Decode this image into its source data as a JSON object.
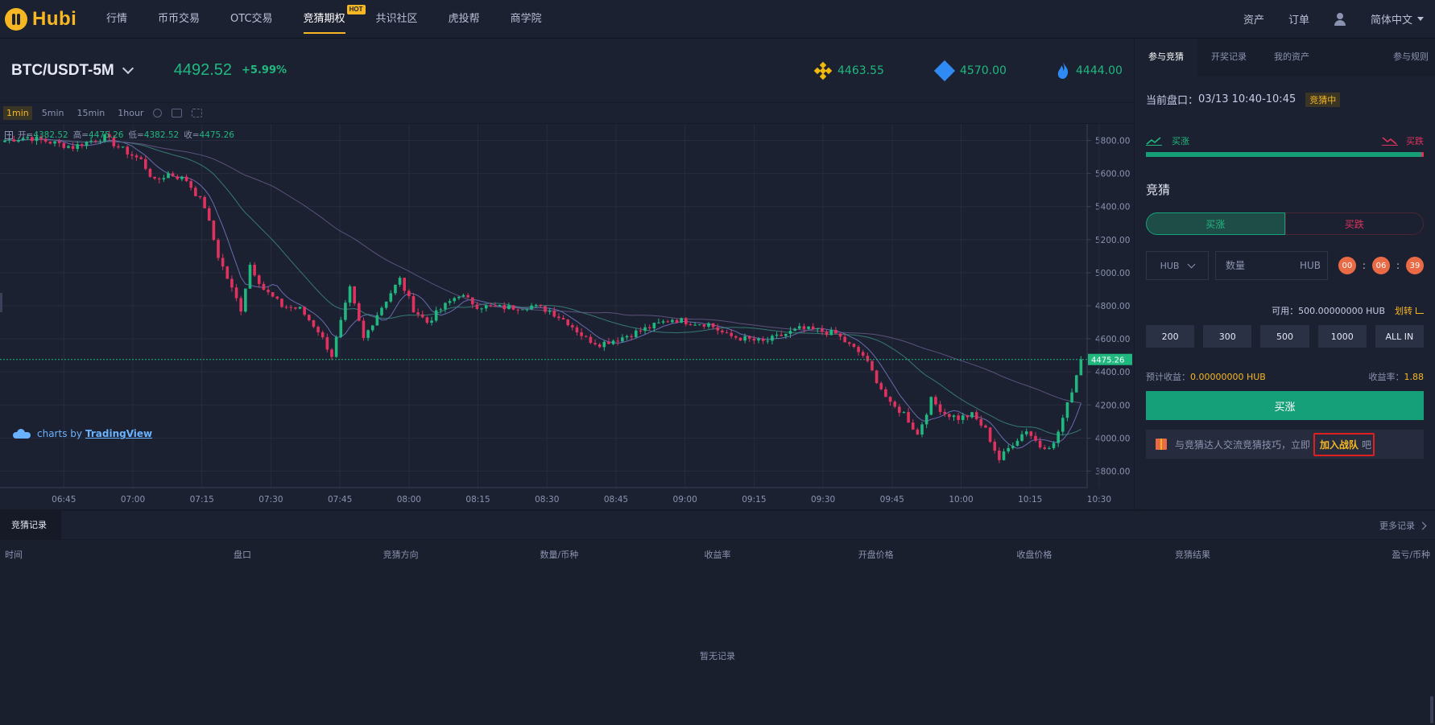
{
  "brand": {
    "name": "Hubi"
  },
  "nav": {
    "items": [
      {
        "label": "行情"
      },
      {
        "label": "币币交易"
      },
      {
        "label": "OTC交易"
      },
      {
        "label": "竞猜期权",
        "badge": "HOT",
        "active": true
      },
      {
        "label": "共识社区"
      },
      {
        "label": "虎投帮"
      },
      {
        "label": "商学院"
      }
    ],
    "right": {
      "assets": "资产",
      "orders": "订单",
      "language": "简体中文"
    }
  },
  "ticker": {
    "pair": "BTC/USDT-5M",
    "last": "4492.52",
    "change": "+5.99%",
    "references": [
      {
        "icon": "binance-icon",
        "value": "4463.55"
      },
      {
        "icon": "okex-icon",
        "value": "4570.00"
      },
      {
        "icon": "huobi-icon",
        "value": "4444.00"
      }
    ]
  },
  "toolbar": {
    "intervals": [
      "1min",
      "5min",
      "15min",
      "1hour"
    ],
    "active": "1min"
  },
  "ohlc": {
    "open_label": "开=",
    "open": "4382.52",
    "high_label": "高=",
    "high": "4475.26",
    "low_label": "低=",
    "low": "4382.52",
    "close_label": "收=",
    "close": "4475.26"
  },
  "tradingview": {
    "prefix": "charts by",
    "name": "TradingView"
  },
  "chart_data": {
    "type": "candlestick",
    "y_ticks": [
      "5800.00",
      "5600.00",
      "5400.00",
      "5200.00",
      "5000.00",
      "4800.00",
      "4600.00",
      "4400.00",
      "4200.00",
      "4000.00",
      "3800.00"
    ],
    "x_ticks": [
      "06:45",
      "07:00",
      "07:15",
      "07:30",
      "07:45",
      "08:00",
      "08:15",
      "08:30",
      "08:45",
      "09:00",
      "09:15",
      "09:30",
      "09:45",
      "10:00",
      "10:15",
      "10:30"
    ],
    "ylim": [
      3700,
      5900
    ],
    "last_price_label": "4475.26",
    "last_price": 4475.26,
    "price_path": [
      [
        0,
        5800
      ],
      [
        5,
        5820
      ],
      [
        10,
        5790
      ],
      [
        15,
        5760
      ],
      [
        18,
        5790
      ],
      [
        22,
        5820
      ],
      [
        25,
        5760
      ],
      [
        30,
        5680
      ],
      [
        33,
        5550
      ],
      [
        36,
        5600
      ],
      [
        40,
        5560
      ],
      [
        44,
        5400
      ],
      [
        47,
        5100
      ],
      [
        50,
        4900
      ],
      [
        52,
        4780
      ],
      [
        54,
        5050
      ],
      [
        57,
        4900
      ],
      [
        61,
        4800
      ],
      [
        65,
        4780
      ],
      [
        69,
        4650
      ],
      [
        72,
        4500
      ],
      [
        74,
        4700
      ],
      [
        76,
        4900
      ],
      [
        79,
        4600
      ],
      [
        82,
        4750
      ],
      [
        85,
        4880
      ],
      [
        87,
        4960
      ],
      [
        90,
        4780
      ],
      [
        93,
        4700
      ],
      [
        96,
        4780
      ],
      [
        100,
        4870
      ],
      [
        104,
        4800
      ],
      [
        108,
        4790
      ],
      [
        112,
        4790
      ],
      [
        116,
        4800
      ],
      [
        120,
        4770
      ],
      [
        124,
        4700
      ],
      [
        128,
        4600
      ],
      [
        131,
        4570
      ],
      [
        135,
        4600
      ],
      [
        139,
        4640
      ],
      [
        143,
        4680
      ],
      [
        147,
        4720
      ],
      [
        151,
        4700
      ],
      [
        155,
        4690
      ],
      [
        159,
        4620
      ],
      [
        163,
        4600
      ],
      [
        167,
        4580
      ],
      [
        171,
        4620
      ],
      [
        175,
        4660
      ],
      [
        179,
        4650
      ],
      [
        183,
        4630
      ],
      [
        186,
        4560
      ],
      [
        189,
        4500
      ],
      [
        192,
        4350
      ],
      [
        195,
        4200
      ],
      [
        198,
        4150
      ],
      [
        201,
        4020
      ],
      [
        204,
        4230
      ],
      [
        207,
        4150
      ],
      [
        210,
        4120
      ],
      [
        213,
        4140
      ],
      [
        216,
        4050
      ],
      [
        219,
        3870
      ],
      [
        222,
        3970
      ],
      [
        225,
        4050
      ],
      [
        228,
        3950
      ],
      [
        231,
        3960
      ],
      [
        234,
        4200
      ],
      [
        237,
        4475
      ]
    ]
  },
  "side": {
    "tabs": [
      "参与竞猜",
      "开奖记录",
      "我的资产"
    ],
    "rules": "参与规则",
    "round_label": "当前盘口：",
    "round_time": "03/13 10:40-10:45",
    "round_status": "竞猜中",
    "trend_up": "买涨",
    "trend_down": "买跌",
    "up_ratio": 0.99,
    "section_title": "竞猜",
    "dir_up": "买涨",
    "dir_down": "买跌",
    "currency": "HUB",
    "qty_placeholder": "数量",
    "qty_unit": "HUB",
    "countdown": [
      "00",
      "06",
      "39"
    ],
    "available": "可用：500.00000000 HUB",
    "transfer": "划转",
    "amounts": [
      "200",
      "300",
      "500",
      "1000",
      "ALL IN"
    ],
    "profit_label": "预计收益：",
    "profit_value": "0.00000000 HUB",
    "rate_label": "收益率：",
    "rate_value": "1.88",
    "buy_button": "买涨",
    "join_text": "与竞猜达人交流竞猜技巧，立即",
    "join_link": "加入战队",
    "join_suffix": "吧"
  },
  "records": {
    "tab": "竞猜记录",
    "more": "更多记录",
    "columns": [
      "时间",
      "盘口",
      "竞猜方向",
      "数量/币种",
      "收益率",
      "开盘价格",
      "收盘价格",
      "竞猜结果",
      "盈亏/币种"
    ],
    "empty": "暂无记录"
  },
  "colors": {
    "up": "#20b87f",
    "down": "#e0325e",
    "accent": "#f6b723",
    "bg": "#1c2131"
  }
}
